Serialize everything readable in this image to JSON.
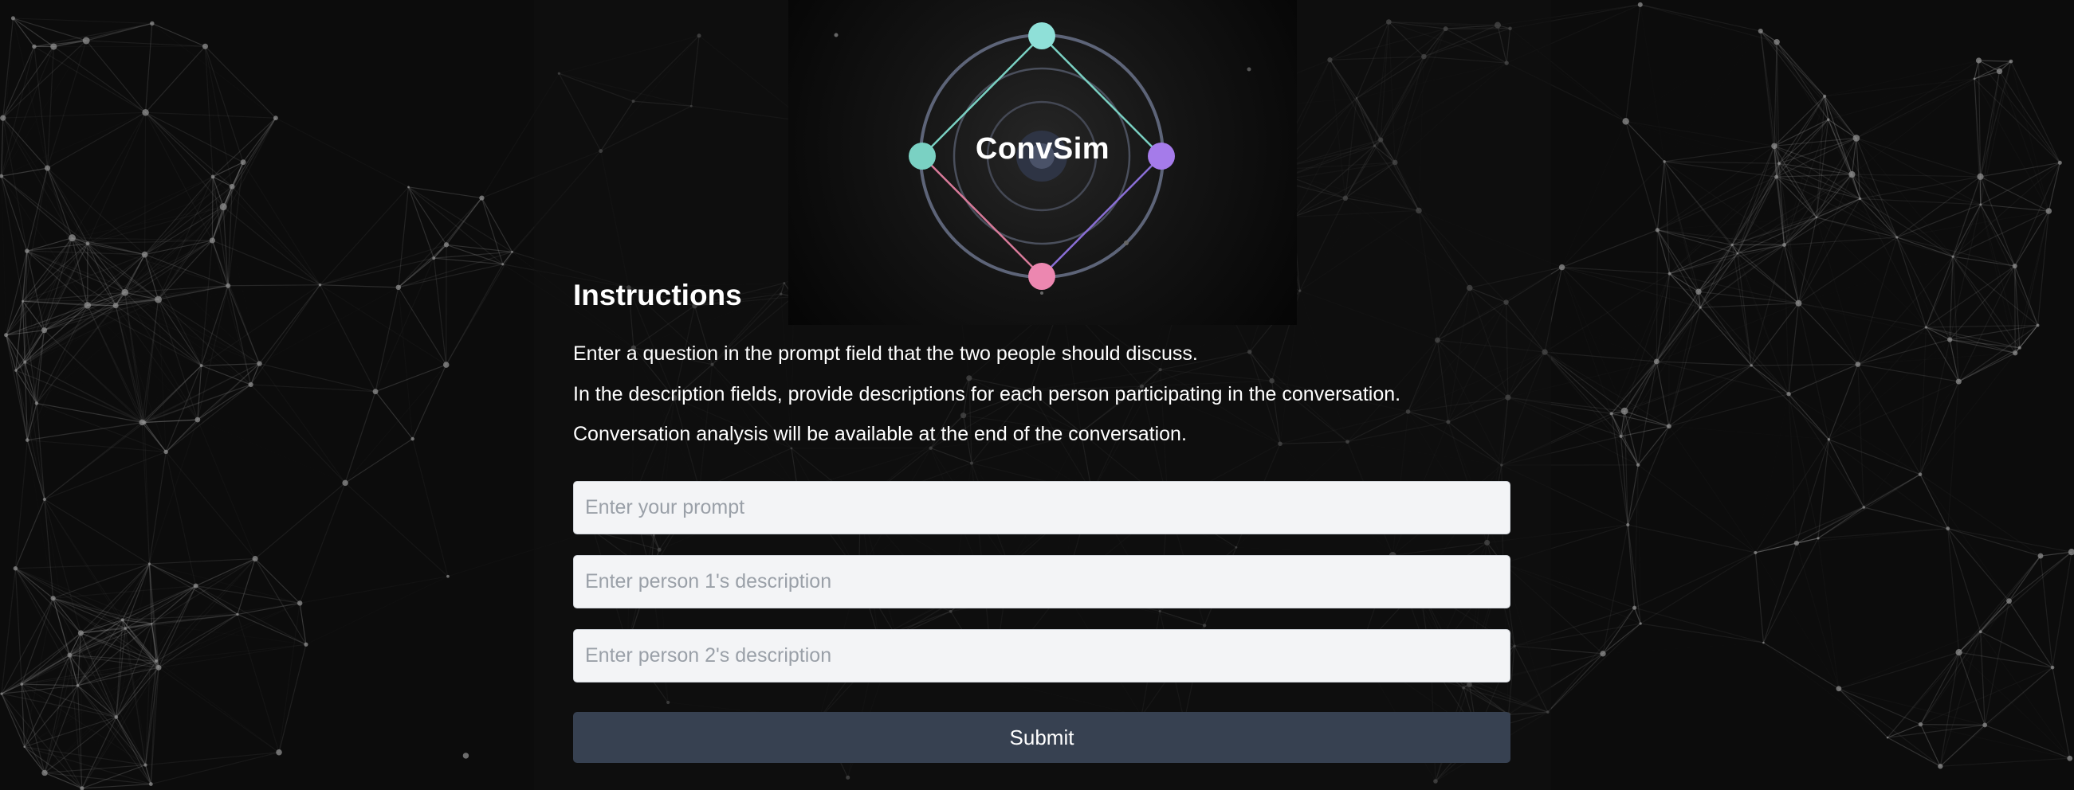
{
  "brand": {
    "title": "ConvSim",
    "node_colors": {
      "top": "#8fe0d8",
      "left": "#7ad1c3",
      "right": "#a57bea",
      "bottom": "#ec87b0",
      "ring": "#5d6478"
    }
  },
  "instructions": {
    "heading": "Instructions",
    "lines": [
      "Enter a question in the prompt field that the two people should discuss.",
      "In the description fields, provide descriptions for each person participating in the conversation.",
      "Conversation analysis will be available at the end of the conversation."
    ]
  },
  "form": {
    "prompt_placeholder": "Enter your prompt",
    "person1_placeholder": "Enter person 1's description",
    "person2_placeholder": "Enter person 2's description",
    "submit_label": "Submit"
  },
  "theme": {
    "background": "#0c0c0c",
    "button": "#374151",
    "input_bg": "#f3f4f6"
  }
}
